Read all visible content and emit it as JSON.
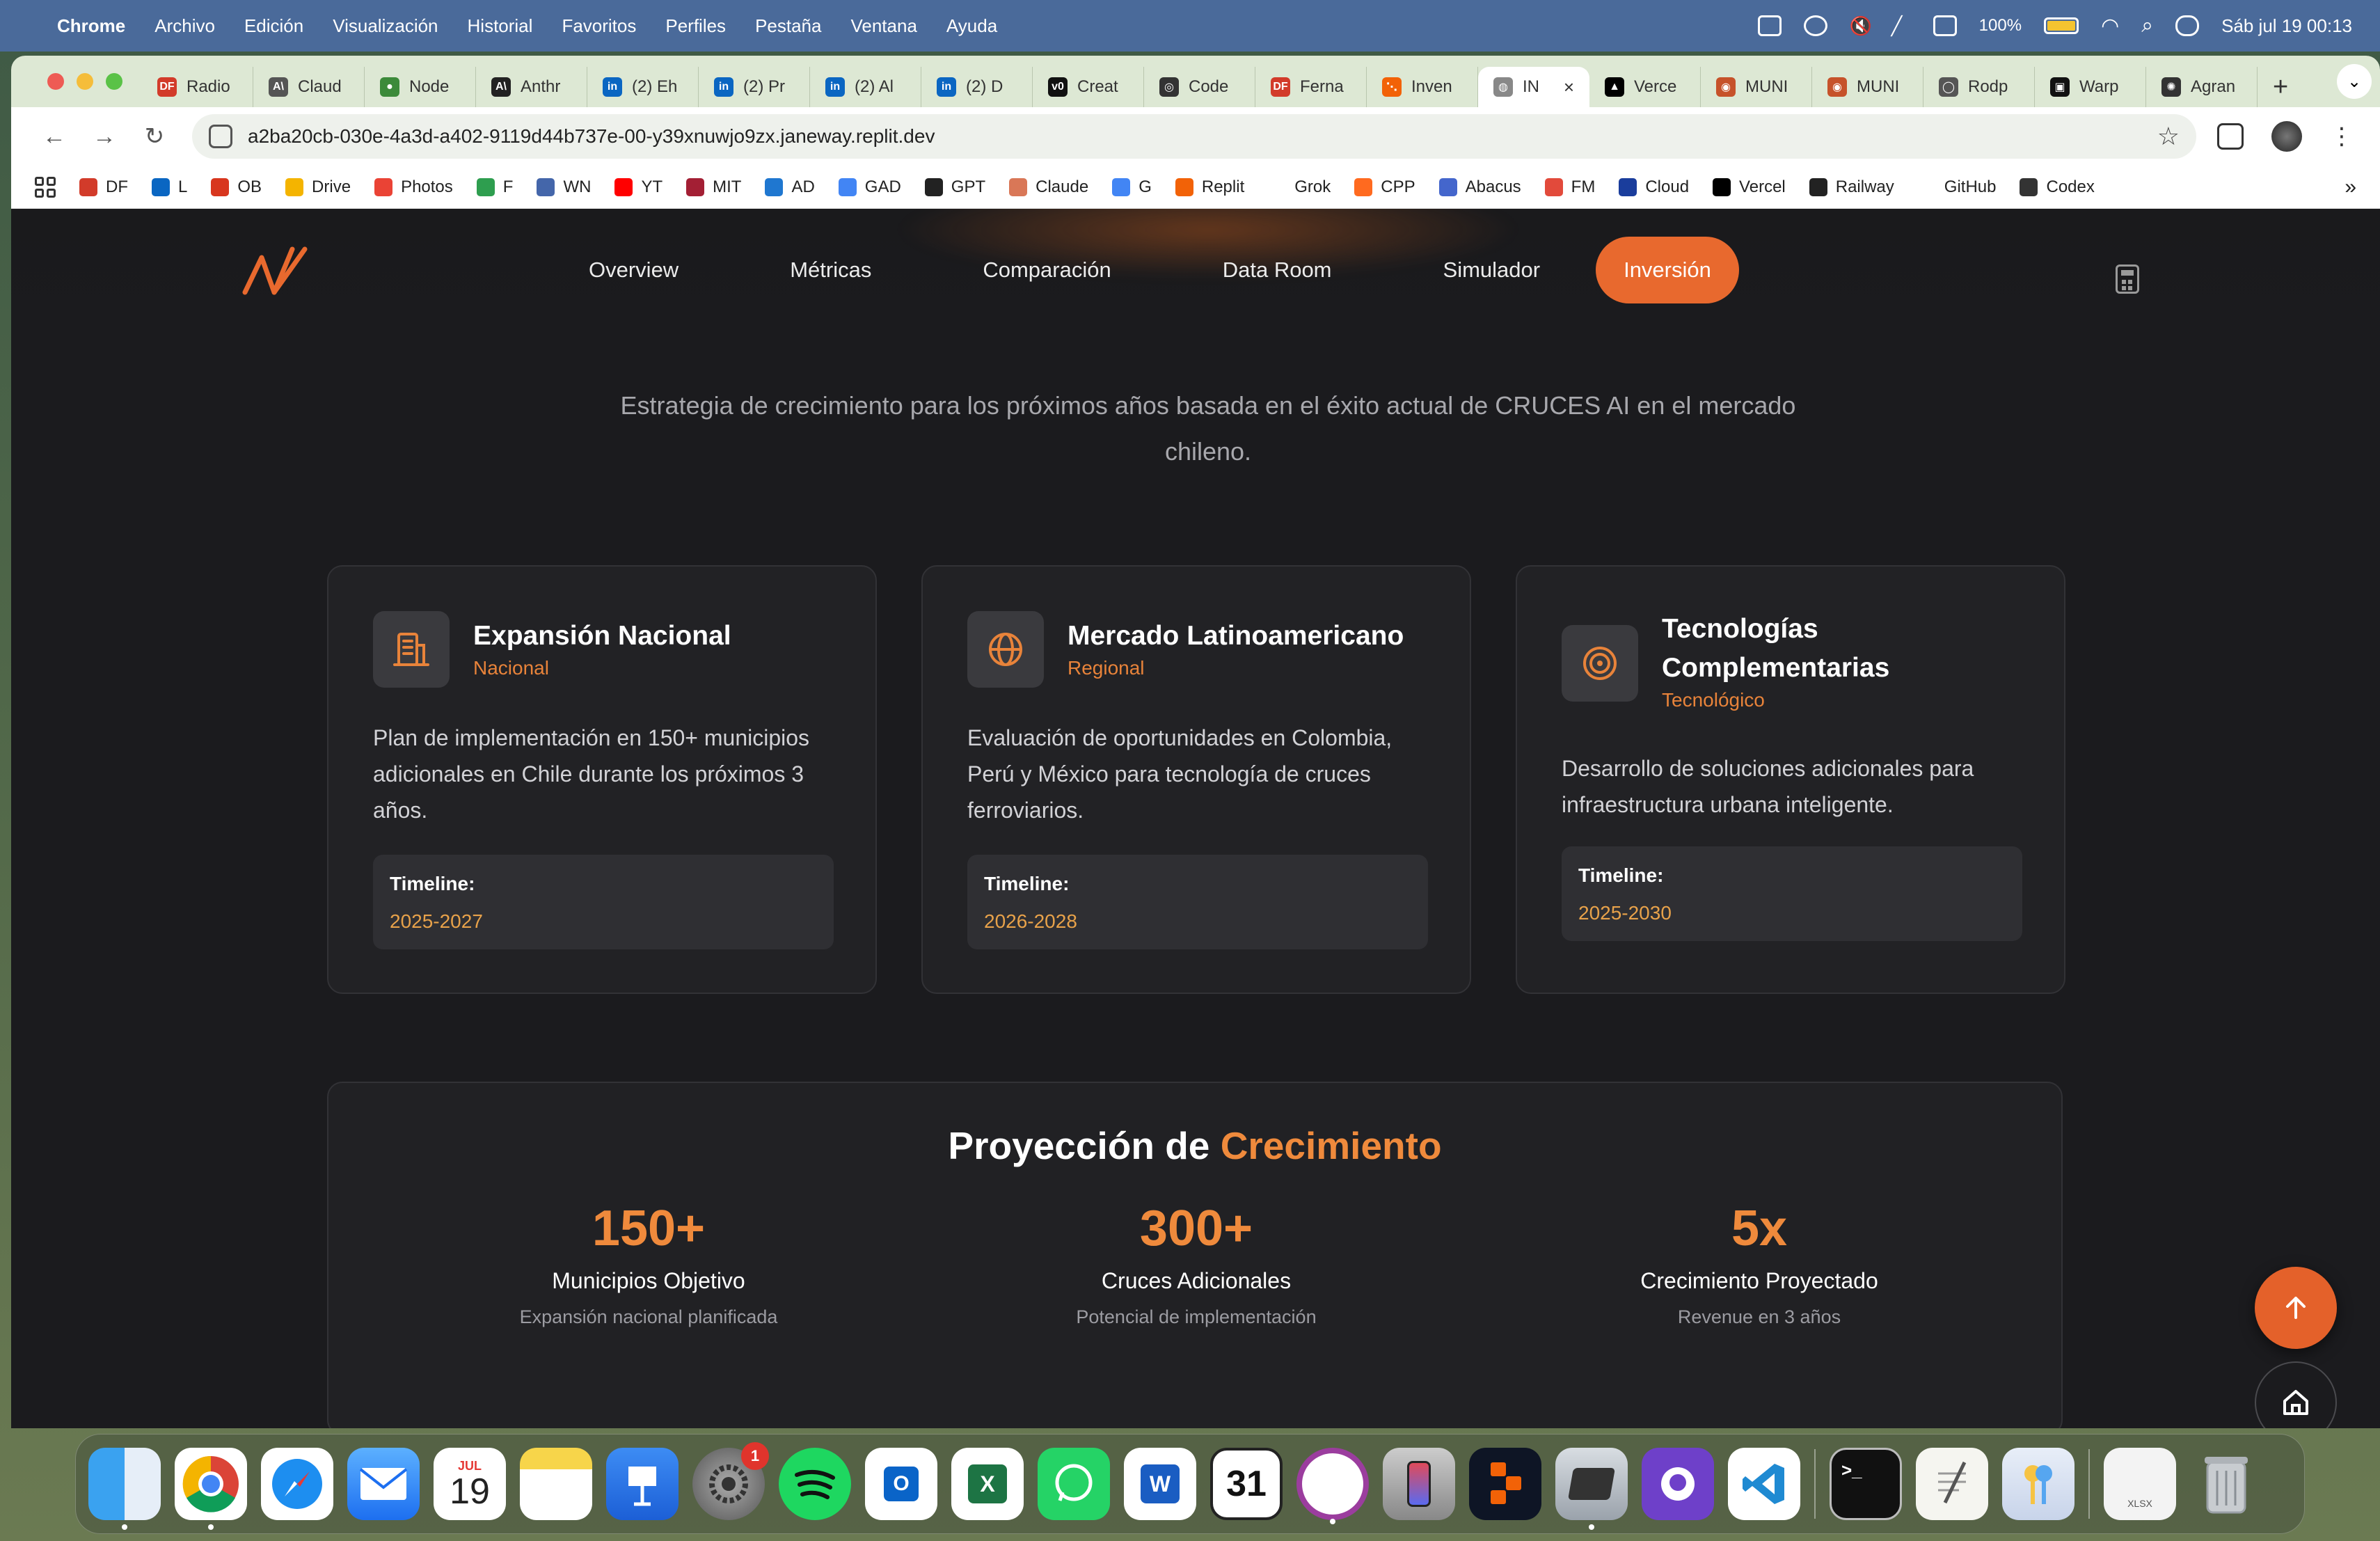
{
  "menubar": {
    "app": "Chrome",
    "items": [
      "Archivo",
      "Edición",
      "Visualización",
      "Historial",
      "Favoritos",
      "Perfiles",
      "Pestaña",
      "Ventana",
      "Ayuda"
    ],
    "battery": "100%",
    "datetime": "Sáb jul 19  00:13"
  },
  "tabs": [
    {
      "label": "Radio",
      "fav": "DF",
      "color": "#d23b2a"
    },
    {
      "label": "Claud",
      "fav": "A\\",
      "color": "#555"
    },
    {
      "label": "Node",
      "fav": "●",
      "color": "#3c8a3a"
    },
    {
      "label": "Anthr",
      "fav": "A\\",
      "color": "#222"
    },
    {
      "label": "(2) Eh",
      "fav": "in",
      "color": "#0a66c2"
    },
    {
      "label": "(2) Pr",
      "fav": "in",
      "color": "#0a66c2"
    },
    {
      "label": "(2) Al",
      "fav": "in",
      "color": "#0a66c2"
    },
    {
      "label": "(2) D",
      "fav": "in",
      "color": "#0a66c2"
    },
    {
      "label": "Creat",
      "fav": "v0",
      "color": "#111"
    },
    {
      "label": "Code",
      "fav": "◎",
      "color": "#333"
    },
    {
      "label": "Ferna",
      "fav": "DF",
      "color": "#d23b2a"
    },
    {
      "label": "Inven",
      "fav": "⋱",
      "color": "#f26207"
    },
    {
      "label": "IN",
      "fav": "◍",
      "color": "#888",
      "active": true
    },
    {
      "label": "Verce",
      "fav": "▲",
      "color": "#000"
    },
    {
      "label": "MUNI",
      "fav": "◉",
      "color": "#c6522a"
    },
    {
      "label": "MUNI",
      "fav": "◉",
      "color": "#c6522a"
    },
    {
      "label": "Rodp",
      "fav": "◯",
      "color": "#555"
    },
    {
      "label": "Warp",
      "fav": "▣",
      "color": "#111"
    },
    {
      "label": "Agran",
      "fav": "✺",
      "color": "#333"
    }
  ],
  "url": "a2ba20cb-030e-4a3d-a402-9119d44b737e-00-y39xnuwjo9zx.janeway.replit.dev",
  "bookmarks": [
    {
      "label": "DF",
      "color": "#d23b2a"
    },
    {
      "label": "L",
      "color": "#0a66c2"
    },
    {
      "label": "OB",
      "color": "#d8361e"
    },
    {
      "label": "Drive",
      "color": "#f4b400"
    },
    {
      "label": "Photos",
      "color": "#ea4335"
    },
    {
      "label": "F",
      "color": "#2e9e4f"
    },
    {
      "label": "WN",
      "color": "#4466aa"
    },
    {
      "label": "YT",
      "color": "#ff0000"
    },
    {
      "label": "MIT",
      "color": "#a31f34"
    },
    {
      "label": "AD",
      "color": "#1f77d0"
    },
    {
      "label": "GAD",
      "color": "#4285f4"
    },
    {
      "label": "GPT",
      "color": "#222"
    },
    {
      "label": "Claude",
      "color": "#d97757"
    },
    {
      "label": "G",
      "color": "#4285f4"
    },
    {
      "label": "Replit",
      "color": "#f26207"
    },
    {
      "label": "Grok",
      "color": "#fff"
    },
    {
      "label": "CPP",
      "color": "#ff6a1f"
    },
    {
      "label": "Abacus",
      "color": "#4466cc"
    },
    {
      "label": "FM",
      "color": "#e24a3b"
    },
    {
      "label": "Cloud",
      "color": "#1a3d9c"
    },
    {
      "label": "Vercel",
      "color": "#000"
    },
    {
      "label": "Railway",
      "color": "#222"
    },
    {
      "label": "GitHub",
      "color": "#fff"
    },
    {
      "label": "Codex",
      "color": "#333"
    }
  ],
  "nav": {
    "links": [
      "Overview",
      "Métricas",
      "Comparación",
      "Data Room",
      "Simulador"
    ],
    "active": "Inversión"
  },
  "subtitle": "Estrategia de crecimiento para los próximos años basada en el éxito actual de CRUCES AI en el mercado chileno.",
  "cards": [
    {
      "title": "Expansión Nacional",
      "category": "Nacional",
      "description": "Plan de implementación en 150+ municipios adicionales en Chile durante los próximos 3 años.",
      "timeline_label": "Timeline:",
      "timeline": "2025-2027",
      "icon": "building-icon"
    },
    {
      "title": "Mercado Latinoamericano",
      "category": "Regional",
      "description": "Evaluación de oportunidades en Colombia, Perú y México para tecnología de cruces ferroviarios.",
      "timeline_label": "Timeline:",
      "timeline": "2026-2028",
      "icon": "globe-icon"
    },
    {
      "title": "Tecnologías Complementarias",
      "category": "Tecnológico",
      "description": "Desarrollo de soluciones adicionales para infraestructura urbana inteligente.",
      "timeline_label": "Timeline:",
      "timeline": "2025-2030",
      "icon": "target-icon"
    }
  ],
  "growth": {
    "title_prefix": "Proyección de",
    "title_highlight": "Crecimiento",
    "stats": [
      {
        "value": "150+",
        "label": "Municipios Objetivo",
        "sub": "Expansión nacional planificada"
      },
      {
        "value": "300+",
        "label": "Cruces Adicionales",
        "sub": "Potencial de implementación"
      },
      {
        "value": "5x",
        "label": "Crecimiento Proyectado",
        "sub": "Revenue en 3 años"
      }
    ]
  },
  "colors": {
    "accent": "#e8692e",
    "accent_text": "#ef8a3c",
    "page_bg": "#1b1b1e",
    "card_bg": "#222225"
  },
  "dock": {
    "calendar_month": "JUL",
    "calendar_day": "19",
    "settings_badge": "1",
    "fantastical_day": "31",
    "excel_file": "XLSX"
  }
}
